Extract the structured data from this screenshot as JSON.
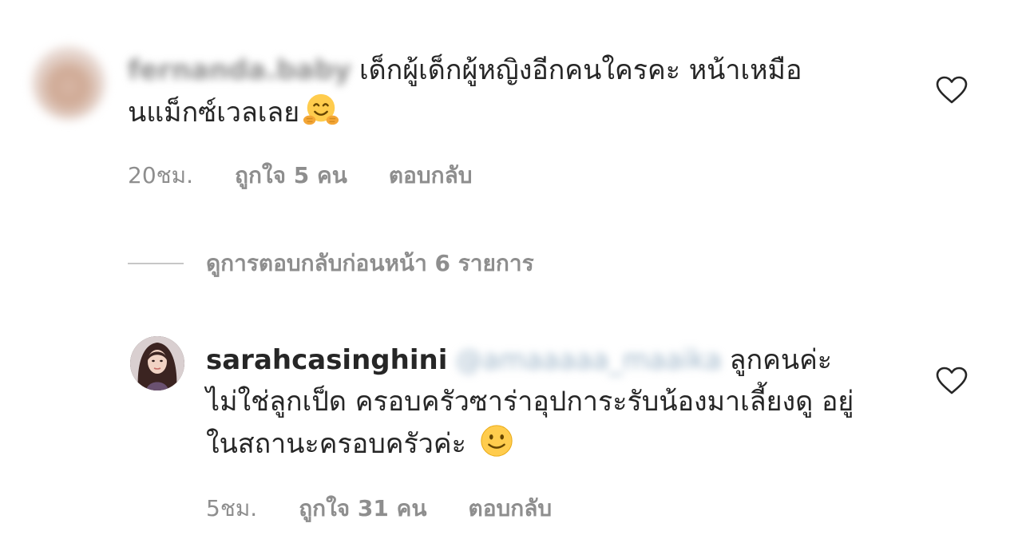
{
  "comment1": {
    "username_blurred": "fernanda.baby",
    "text": "เด็กผู้เด็กผู้หญิงอีกคนใครคะ หน้าเหมือนแม็กซ์เวลเลย",
    "emoji": "hugging-face",
    "time": "20ชม.",
    "likes": "ถูกใจ 5 คน",
    "reply_label": "ตอบกลับ"
  },
  "view_replies": {
    "label": "ดูการตอบกลับก่อนหน้า 6 รายการ"
  },
  "comment2": {
    "username": "sarahcasinghini",
    "mention_blurred": "@amaaaaa_maaika",
    "text": "ลูกคนค่ะ ไม่ใช่ลูกเป็ด ครอบครัวซาร่าอุปการะรับน้องมาเลี้ยงดู อยู่ในสถานะครอบครัวค่ะ",
    "emoji": "slightly-smiling-face",
    "time": "5ชม.",
    "likes": "ถูกใจ 31 คน",
    "reply_label": "ตอบกลับ"
  },
  "colors": {
    "text": "#262626",
    "secondary": "#8e8e8e",
    "divider": "#c7c7c7"
  }
}
